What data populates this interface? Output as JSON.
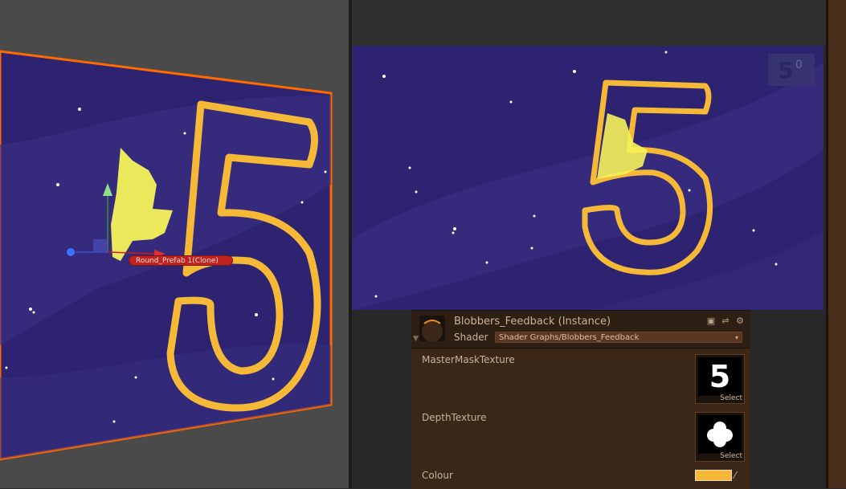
{
  "scene": {
    "object_label": "Round_Prefab 1(Clone)",
    "digit": "5"
  },
  "game": {
    "digit": "5",
    "score": "5",
    "score_sub": "0"
  },
  "inspector": {
    "material_title": "Blobbers_Feedback (Instance)",
    "shader_label": "Shader",
    "shader_value": "Shader Graphs/Blobbers_Feedback",
    "properties": [
      {
        "label": "MasterMaskTexture",
        "select": "Select",
        "preview_text": "5"
      },
      {
        "label": "DepthTexture",
        "select": "Select"
      },
      {
        "label": "Colour"
      }
    ],
    "colour_value": "#f5b937"
  },
  "colors": {
    "background_purple": "#2d2370",
    "accent_orange": "#f5b937",
    "selection_orange": "#ff6a00"
  }
}
